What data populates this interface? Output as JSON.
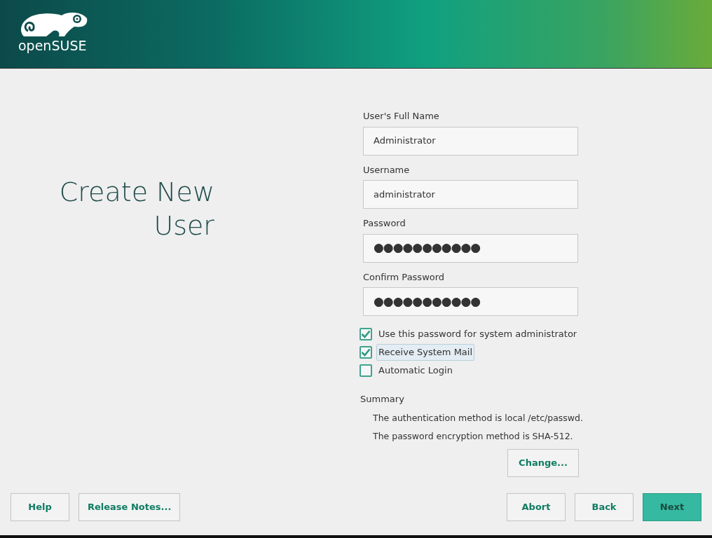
{
  "logo": {
    "text": "openSUSE"
  },
  "title": "Create New User",
  "fields": [
    {
      "label": "User's Full Name",
      "value": "Administrator",
      "kind": "text"
    },
    {
      "label": "Username",
      "value": "administrator",
      "kind": "text"
    },
    {
      "label": "Password",
      "value": "●●●●●●●●●●●",
      "kind": "password"
    },
    {
      "label": "Confirm Password",
      "value": "●●●●●●●●●●●",
      "kind": "password"
    }
  ],
  "options": [
    {
      "label": "Use this password for system administrator",
      "checked": true,
      "focused": false
    },
    {
      "label": "Receive System Mail",
      "checked": true,
      "focused": true
    },
    {
      "label": "Automatic Login",
      "checked": false,
      "focused": false
    }
  ],
  "summary": {
    "heading": "Summary",
    "lines": [
      "The authentication method is local /etc/passwd.",
      "The password encryption method is SHA-512."
    ],
    "button": "Change..."
  },
  "buttons_left": [
    {
      "label": "Help",
      "primary": false
    },
    {
      "label": "Release Notes...",
      "primary": false
    }
  ],
  "buttons_right": [
    {
      "label": "Abort",
      "primary": false
    },
    {
      "label": "Back",
      "primary": false
    },
    {
      "label": "Next",
      "primary": true
    }
  ]
}
